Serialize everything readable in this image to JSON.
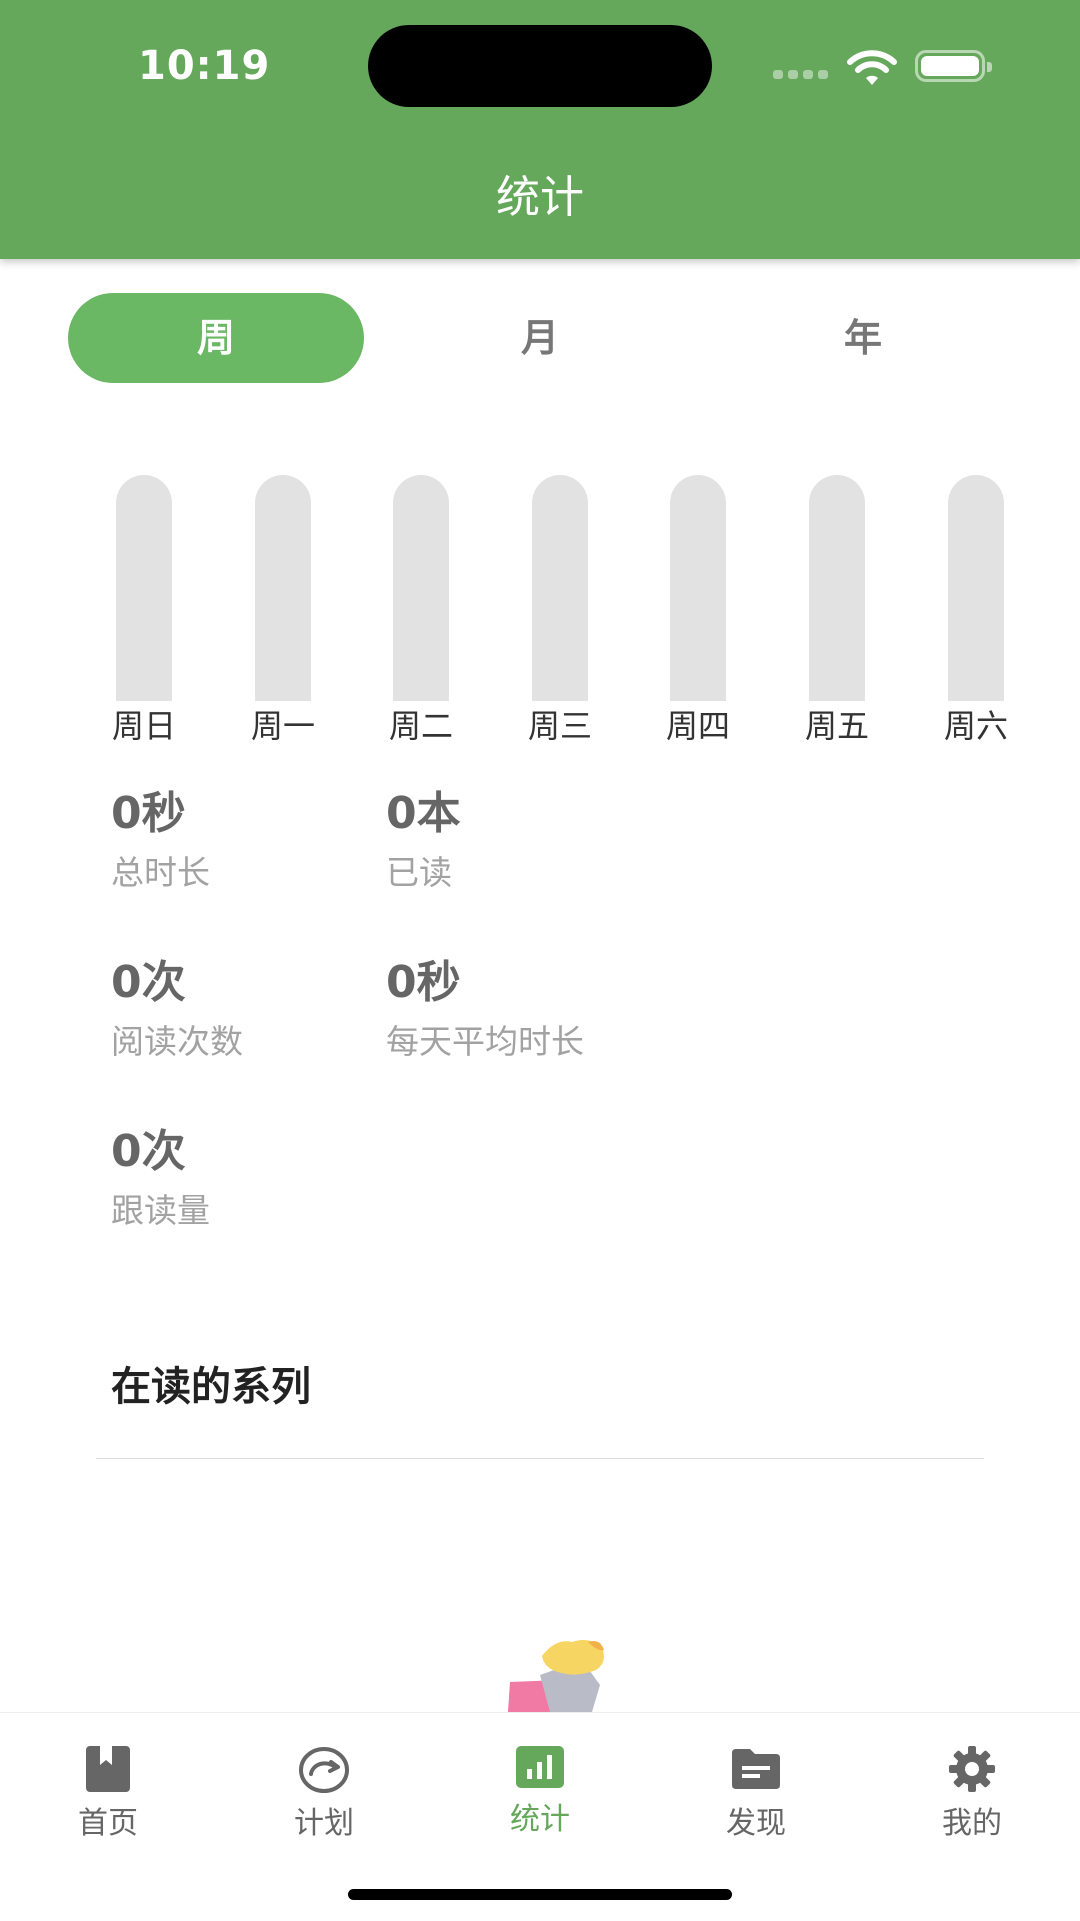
{
  "status_bar": {
    "time": "10:19"
  },
  "header": {
    "title": "统计"
  },
  "period_tabs": [
    {
      "label": "周",
      "active": true
    },
    {
      "label": "月",
      "active": false
    },
    {
      "label": "年",
      "active": false
    }
  ],
  "chart_data": {
    "type": "bar",
    "categories": [
      "周日",
      "周一",
      "周二",
      "周三",
      "周四",
      "周五",
      "周六"
    ],
    "values": [
      0,
      0,
      0,
      0,
      0,
      0,
      0
    ],
    "title": "",
    "xlabel": "",
    "ylabel": "",
    "ylim": [
      0,
      1
    ],
    "colors": {
      "track": "#e2e2e2",
      "fill": "#6ab764"
    }
  },
  "stats": {
    "total_duration": {
      "value": "0秒",
      "label": "总时长"
    },
    "books_read": {
      "value": "0本",
      "label": "已读"
    },
    "read_count": {
      "value": "0次",
      "label": "阅读次数"
    },
    "daily_avg": {
      "value": "0秒",
      "label": "每天平均时长"
    },
    "follow_read": {
      "value": "0次",
      "label": "跟读量"
    }
  },
  "reading_series": {
    "title": "在读的系列"
  },
  "tabbar": {
    "items": [
      {
        "label": "首页",
        "icon": "book-icon",
        "active": false
      },
      {
        "label": "计划",
        "icon": "plan-gauge-icon",
        "active": false
      },
      {
        "label": "统计",
        "icon": "chart-icon",
        "active": true
      },
      {
        "label": "发现",
        "icon": "folder-icon",
        "active": false
      },
      {
        "label": "我的",
        "icon": "gear-icon",
        "active": false
      }
    ]
  },
  "colors": {
    "brand_green": "#65a75b",
    "active_tab_green": "#6ab764",
    "inactive_text": "#666666"
  }
}
